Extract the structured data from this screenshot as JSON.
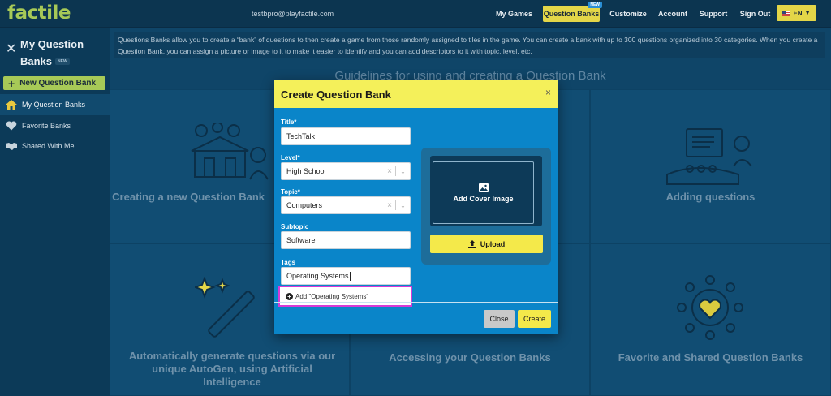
{
  "app": {
    "logo": "factile",
    "email": "testbpro@playfactile.com"
  },
  "nav": {
    "my_games": "My Games",
    "question_banks": "Question Banks",
    "question_banks_badge": "NEW",
    "customize": "Customize",
    "account": "Account",
    "support": "Support",
    "sign_out": "Sign Out",
    "language": "EN"
  },
  "sidebar": {
    "title": "My Question Banks",
    "title_badge": "NEW",
    "new_button": "New Question Bank",
    "items": [
      {
        "label": "My Question Banks",
        "icon": "home-icon"
      },
      {
        "label": "Favorite Banks",
        "icon": "heart-icon"
      },
      {
        "label": "Shared With Me",
        "icon": "handshake-icon"
      }
    ]
  },
  "main": {
    "info": "Questions Banks allow you to create a “bank” of questions to then create a game from those randomly assigned to tiles in the game. You can create a bank with up to 300 questions organized into 30 categories. When you create a Question Bank, you can assign a picture or image to it to make it easier to identify and you can add descriptors to it with topic, level, etc.",
    "guidelines_heading": "Guidelines for using and creating a Question Bank",
    "cards": [
      {
        "label": "Creating a new Question Bank"
      },
      {
        "label": "Adding questions"
      },
      {
        "label": "Automatically generate questions via our unique AutoGen, using Artificial Intelligence"
      },
      {
        "label": "Accessing your Question Banks"
      },
      {
        "label": "Favorite and Shared Question Banks"
      }
    ]
  },
  "modal": {
    "title": "Create Question Bank",
    "close_x": "×",
    "fields": {
      "title_label": "Title*",
      "title_value": "TechTalk",
      "level_label": "Level*",
      "level_value": "High School",
      "topic_label": "Topic*",
      "topic_value": "Computers",
      "subtopic_label": "Subtopic",
      "subtopic_value": "Software",
      "tags_label": "Tags",
      "tags_value": "Operating Systems"
    },
    "suggestion": "Add \"Operating Systems\"",
    "cover_label": "Add Cover Image",
    "upload_label": "Upload",
    "close_button": "Close",
    "create_button": "Create"
  },
  "colors": {
    "accent_yellow": "#f4e94a",
    "modal_blue": "#0a85c9",
    "brand_green": "#a7c957",
    "highlight": "#d63ad6"
  }
}
